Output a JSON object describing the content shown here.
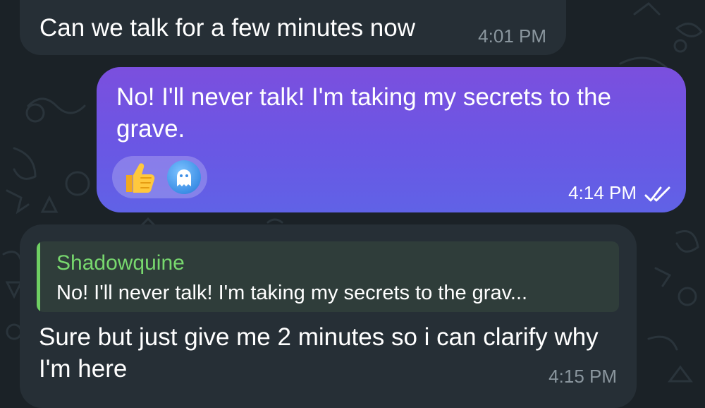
{
  "messages": {
    "incoming_1": {
      "text": "Can we talk for a few minutes now",
      "time": "4:01 PM"
    },
    "outgoing": {
      "text": "No! I'll never talk! I'm taking my secrets to the grave.",
      "time": "4:14 PM",
      "status_icon": "double-check-icon",
      "reactions": [
        {
          "icon": "thumbs-up-icon"
        },
        {
          "icon": "ghost-icon"
        }
      ]
    },
    "incoming_2": {
      "reply_to": {
        "name": "Shadowquine",
        "text": "No! I'll never talk! I'm taking my secrets to the grav..."
      },
      "text": "Sure but just give me 2 minutes so i can clarify why I'm here",
      "time": "4:15 PM"
    }
  },
  "colors": {
    "background": "#1b2227",
    "incoming_bubble": "#262f36",
    "outgoing_bubble_top": "#7b4fde",
    "outgoing_bubble_bottom": "#6062e6",
    "reply_accent": "#6fcf63",
    "time_incoming": "#8a969e"
  }
}
